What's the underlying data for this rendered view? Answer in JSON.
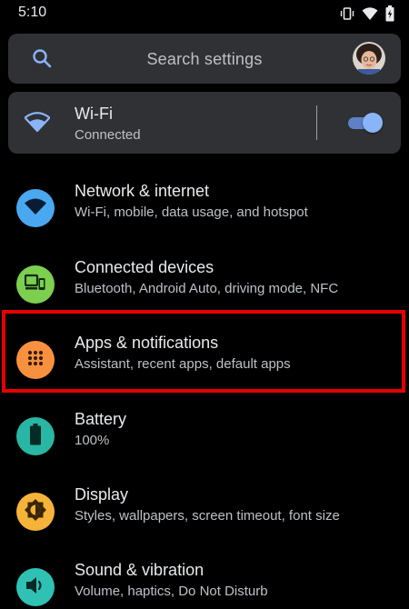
{
  "status_bar": {
    "time": "5:10",
    "icons": [
      "vibrate-icon",
      "wifi-signal-icon",
      "battery-charging-icon"
    ]
  },
  "search": {
    "placeholder": "Search settings",
    "icon": "search-icon"
  },
  "wifi_card": {
    "title": "Wi-Fi",
    "status": "Connected",
    "toggle_on": true
  },
  "menu": [
    {
      "title": "Network & internet",
      "subtitle": "Wi-Fi, mobile, data usage, and hotspot",
      "icon": "wifi-icon",
      "color": "#4aa8f0"
    },
    {
      "title": "Connected devices",
      "subtitle": "Bluetooth, Android Auto, driving mode, NFC",
      "icon": "devices-icon",
      "color": "#7ccf4f"
    },
    {
      "title": "Apps & notifications",
      "subtitle": "Assistant, recent apps, default apps",
      "icon": "apps-icon",
      "color": "#f7913f"
    },
    {
      "title": "Battery",
      "subtitle": "100%",
      "icon": "battery-icon",
      "color": "#29b6a4"
    },
    {
      "title": "Display",
      "subtitle": "Styles, wallpapers, screen timeout, font size",
      "icon": "brightness-icon",
      "color": "#f6b33a"
    },
    {
      "title": "Sound & vibration",
      "subtitle": "Volume, haptics, Do Not Disturb",
      "icon": "volume-icon",
      "color": "#2fc1b3"
    }
  ],
  "highlight_color": "#e60000"
}
